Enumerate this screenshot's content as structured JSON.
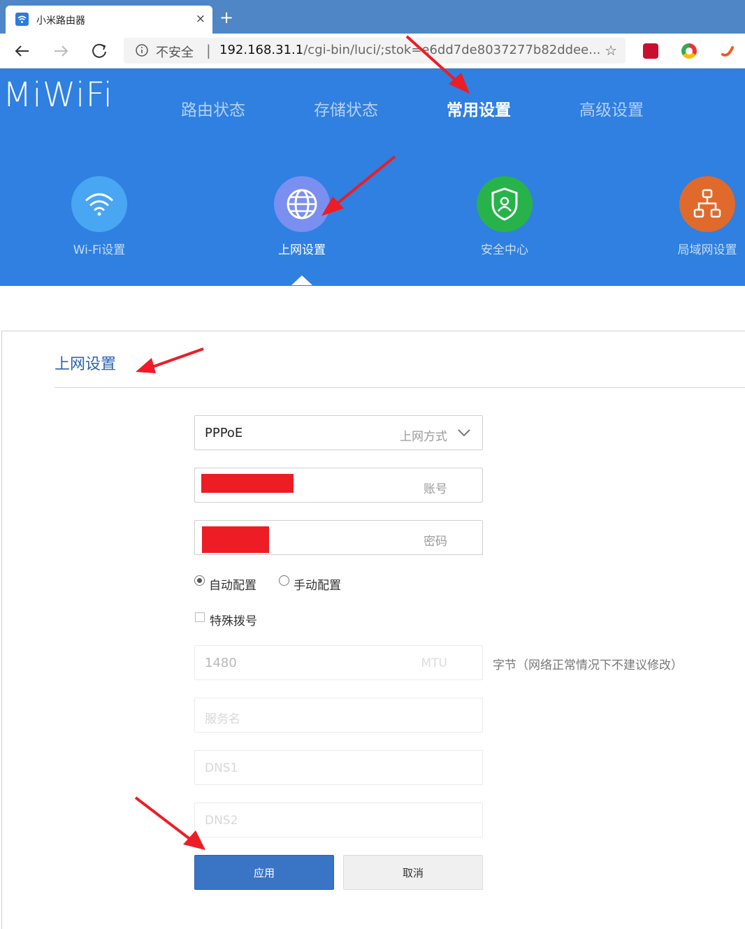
{
  "browser": {
    "tab_title": "小米路由器",
    "close_glyph": "×",
    "newtab_glyph": "+",
    "insecure_label": "不安全",
    "address_separator": "|",
    "url_host": "192.168.31.1",
    "url_path": "/cgi-bin/luci/;stok=e6dd7de8037277b82ddee...",
    "star_glyph": "☆"
  },
  "router": {
    "logo": "MiWiFi",
    "main_nav": [
      {
        "label": "路由状态"
      },
      {
        "label": "存储状态"
      },
      {
        "label": "常用设置"
      },
      {
        "label": "高级设置"
      }
    ],
    "sub_nav": [
      {
        "label": "Wi-Fi设置"
      },
      {
        "label": "上网设置"
      },
      {
        "label": "安全中心"
      },
      {
        "label": "局域网设置"
      }
    ]
  },
  "form": {
    "title": "上网设置",
    "connection": {
      "value": "PPPoE",
      "label": "上网方式"
    },
    "account_label": "账号",
    "password_label": "密码",
    "auto_config": "自动配置",
    "manual_config": "手动配置",
    "special_dial": "特殊拨号",
    "mtu": {
      "value": "1480",
      "label": "MTU",
      "hint": "字节（网络正常情况下不建议修改）"
    },
    "service_placeholder": "服务名",
    "dns1_placeholder": "DNS1",
    "dns2_placeholder": "DNS2",
    "apply": "应用",
    "cancel": "取消"
  },
  "colors": {
    "header_blue": "#2f80e0",
    "apply_blue": "#3a74c5",
    "annotation_red": "#ee1c25",
    "wifi_icon": "#49a6f2",
    "internet_icon": "#7b8ff0",
    "security_icon": "#27b34a",
    "lan_icon": "#e06a2c"
  }
}
